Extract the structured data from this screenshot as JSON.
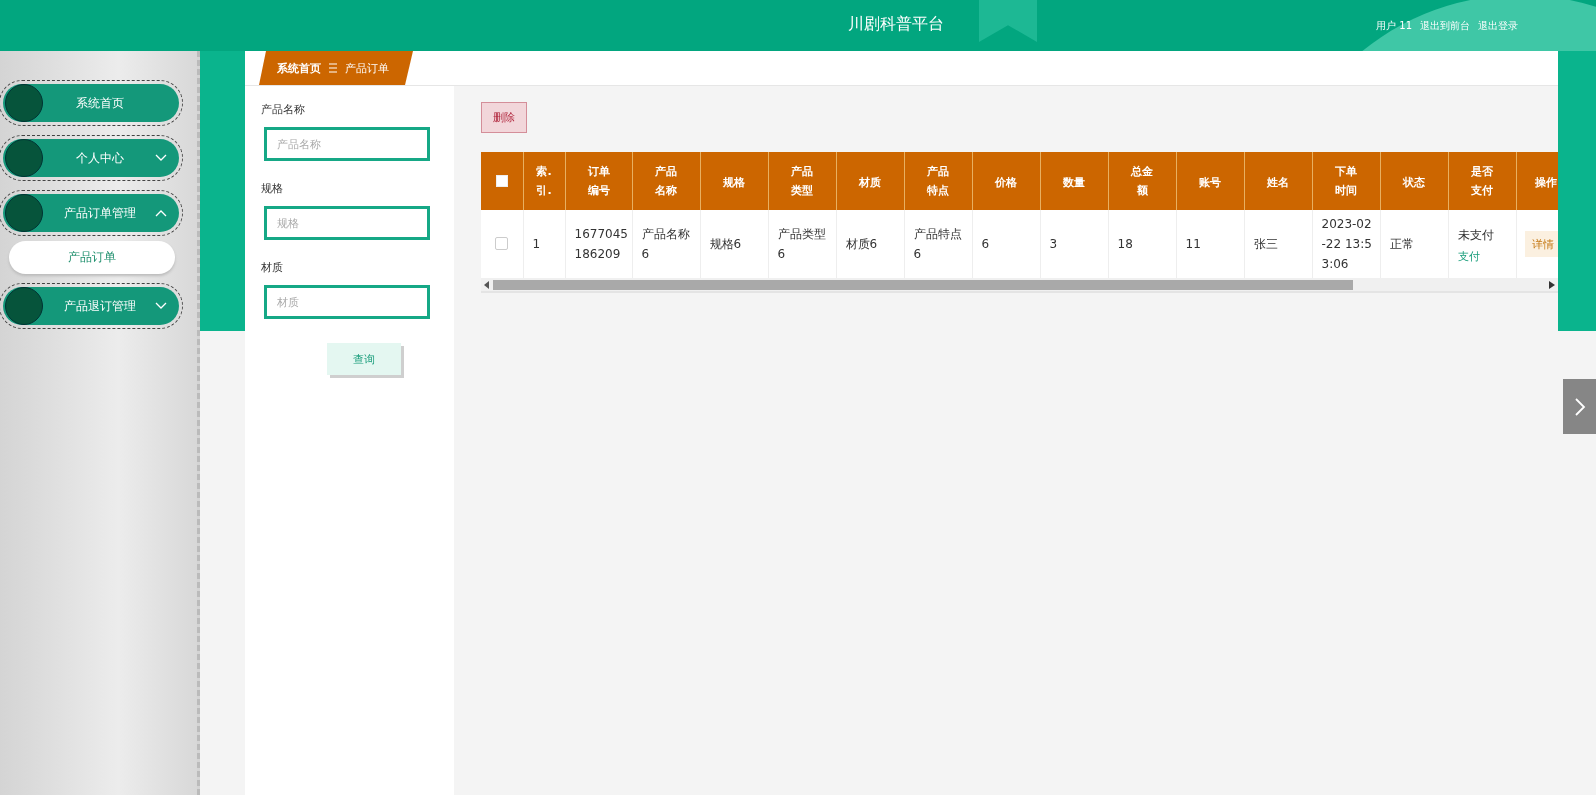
{
  "header": {
    "title": "川剧科普平台",
    "links": [
      "用户 11",
      "退出到前台",
      "退出登录"
    ]
  },
  "sidebar": {
    "items": [
      {
        "label": "系统首页",
        "kind": "link"
      },
      {
        "label": "个人中心",
        "kind": "group",
        "expanded": false
      },
      {
        "label": "产品订单管理",
        "kind": "group",
        "expanded": true,
        "children": [
          {
            "label": "产品订单",
            "selected": true
          }
        ]
      },
      {
        "label": "产品退订管理",
        "kind": "group",
        "expanded": false
      }
    ]
  },
  "breadcrumb": [
    "系统首页",
    "产品订单"
  ],
  "search_form": {
    "fields": [
      {
        "label": "产品名称",
        "placeholder": "产品名称"
      },
      {
        "label": "规格",
        "placeholder": "规格"
      },
      {
        "label": "材质",
        "placeholder": "材质"
      }
    ],
    "button": "查询"
  },
  "toolbar": {
    "delete_button": "删除"
  },
  "table": {
    "select_all_checked": false,
    "columns": [
      "索.引.",
      "订单编号",
      "产品名称",
      "规格",
      "产品类型",
      "材质",
      "产品特点",
      "价格",
      "数量",
      "总金额",
      "账号",
      "姓名",
      "下单时间",
      "状态",
      "是否支付",
      "操作"
    ],
    "rows": [
      {
        "checked": false,
        "cells": [
          "1",
          "1677045\n186209",
          "产品名称\n6",
          "规格6",
          "产品类型\n6",
          "材质6",
          "产品特点\n6",
          "6",
          "3",
          "18",
          "11",
          "张三",
          "2023-02\n-22 13:5\n3:06",
          "正常"
        ],
        "pay_status": "未支付",
        "pay_link": "支付",
        "detail_button": "详情"
      }
    ]
  }
}
